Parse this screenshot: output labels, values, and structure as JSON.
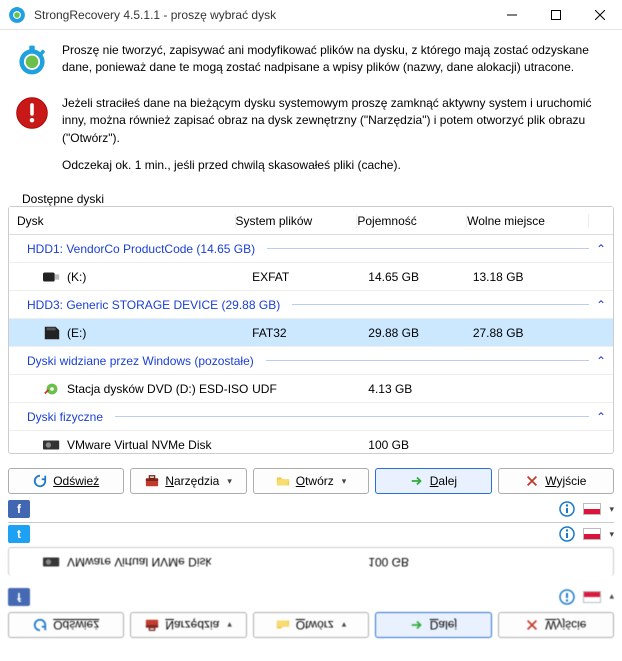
{
  "window": {
    "title": "StrongRecovery 4.5.1.1 - proszę wybrać dysk"
  },
  "info": {
    "p1": "Proszę nie tworzyć, zapisywać ani modyfikować plików na dysku, z którego mają zostać odzyskane dane, ponieważ dane te mogą zostać nadpisane a wpisy plików (nazwy, dane alokacji) utracone.",
    "p2": "Jeżeli straciłeś dane na bieżącym dysku systemowym proszę zamknąć aktywny system i uruchomić inny, można również zapisać obraz na dysk zewnętrzny (\"Narzędzia\") i potem otworzyć plik obrazu (\"Otwórz\").",
    "p3": "Odczekaj ok. 1 min., jeśli przed chwilą skasowałeś pliki (cache)."
  },
  "groupbox": {
    "label": "Dostępne dyski"
  },
  "columns": {
    "dysk": "Dysk",
    "fs": "System plików",
    "cap": "Pojemność",
    "free": "Wolne miejsce"
  },
  "groups": {
    "g1": "HDD1: VendorCo ProductCode (14.65 GB)",
    "g2": "HDD3: Generic  STORAGE DEVICE (29.88 GB)",
    "g3": "Dyski widziane przez Windows (pozostałe)",
    "g4": "Dyski fizyczne"
  },
  "rows": {
    "r1": {
      "name": "(K:)",
      "fs": "EXFAT",
      "cap": "14.65 GB",
      "free": "13.18 GB"
    },
    "r2": {
      "name": "(E:)",
      "fs": "FAT32",
      "cap": "29.88 GB",
      "free": "27.88 GB"
    },
    "r3": {
      "name": "Stacja dysków DVD (D:) ESD-ISO",
      "fs": "UDF",
      "cap": "4.13 GB",
      "free": ""
    },
    "r4": {
      "name": "VMware Virtual NVMe Disk",
      "fs": "",
      "cap": "100 GB",
      "free": ""
    }
  },
  "buttons": {
    "refresh": "Odśwież",
    "tools": "Narzędzia",
    "open": "Otwórz",
    "next": "Dalej",
    "exit": "Wyjście"
  }
}
